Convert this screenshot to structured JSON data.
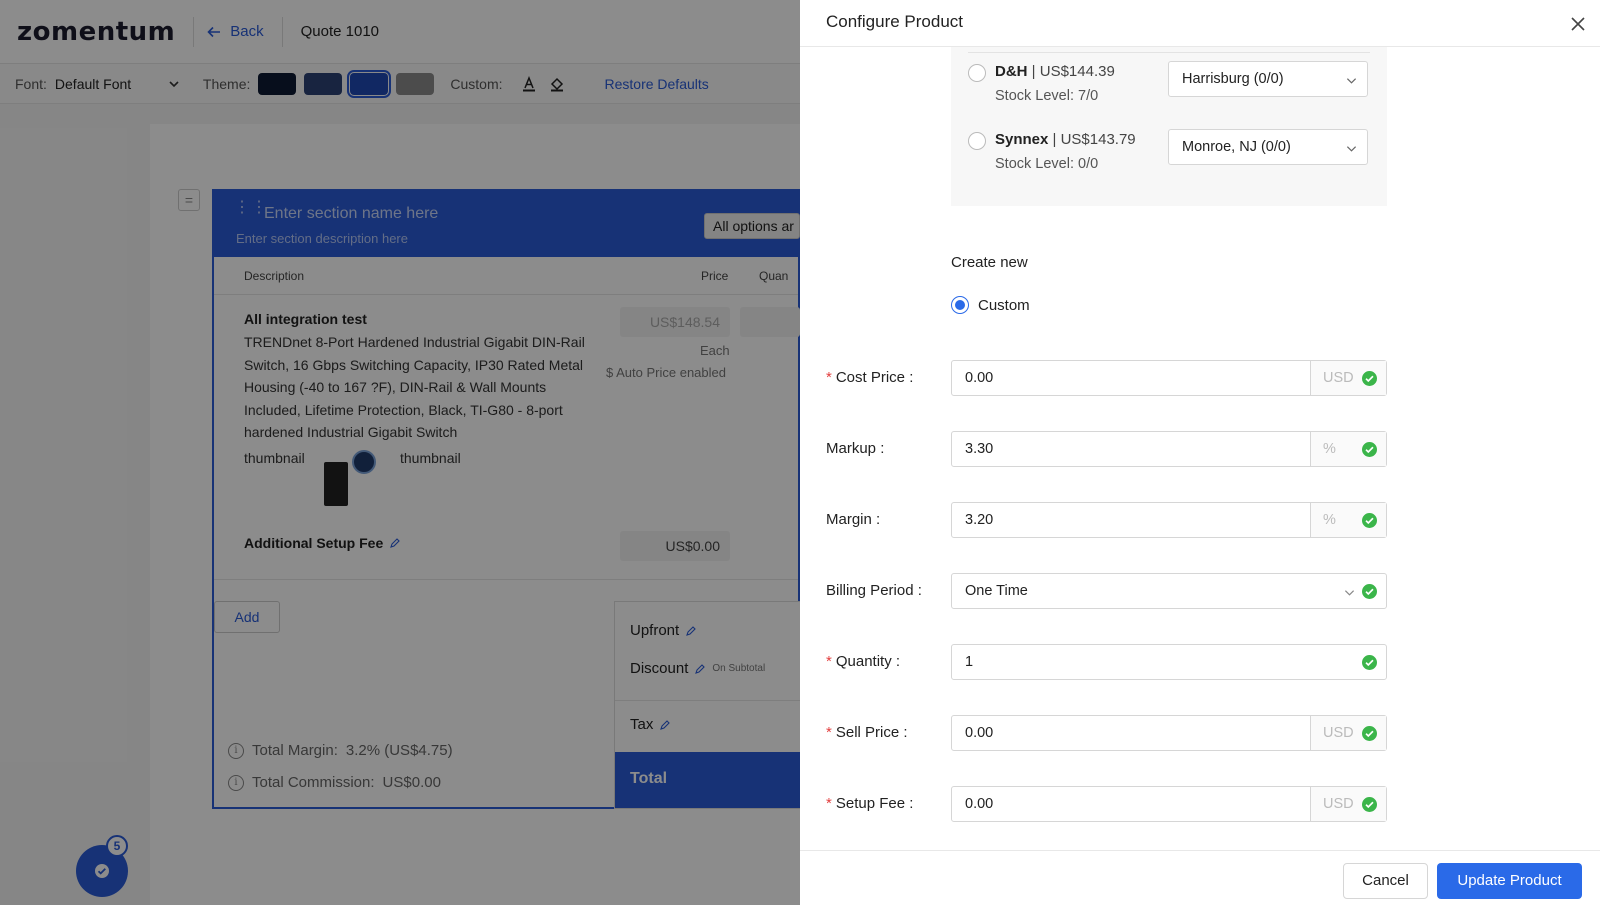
{
  "app": {
    "logo": "zomentum",
    "back_label": "Back",
    "quote_title": "Quote 1010"
  },
  "toolbar": {
    "font_label": "Font:",
    "font_value": "Default Font",
    "theme_label": "Theme:",
    "theme_swatches": [
      "#0e1a33",
      "#2c4275",
      "#1f49b5",
      "#8a8a8a"
    ],
    "custom_label": "Custom:",
    "restore_label": "Restore Defaults"
  },
  "section": {
    "name_placeholder": "Enter section name here",
    "description_placeholder": "Enter section description here",
    "options_pill": "All options ar",
    "columns": {
      "description": "Description",
      "price": "Price",
      "quantity": "Quan"
    },
    "item": {
      "title": "All integration test",
      "description": "TRENDnet 8-Port Hardened Industrial Gigabit DIN-Rail Switch, 16 Gbps Switching Capacity, IP30 Rated Metal Housing (-40 to 167 ?F), DIN-Rail & Wall Mounts Included, Lifetime Protection, Black, TI-G80 - 8-port hardened Industrial Gigabit Switch",
      "price": "US$148.54",
      "unit": "Each",
      "auto_price": "$ Auto Price enabled",
      "thumbnails": [
        "thumbnail",
        "thumbnail"
      ],
      "setup_fee_label": "Additional Setup Fee",
      "setup_fee_value": "US$0.00"
    },
    "add_label": "Add",
    "summary": {
      "upfront": "Upfront",
      "discount": "Discount",
      "on_subtotal": "On Subtotal",
      "tax": "Tax",
      "total": "Total"
    },
    "total_margin_label": "Total Margin:",
    "total_margin_value": "3.2% (US$4.75)",
    "total_commission_label": "Total Commission:",
    "total_commission_value": "US$0.00"
  },
  "fab": {
    "badge_count": "5"
  },
  "drawer": {
    "title": "Configure Product",
    "suppliers": [
      {
        "name": "D&H",
        "price": "| US$144.39",
        "stock": "Stock Level: 7/0",
        "warehouse": "Harrisburg (0/0)"
      },
      {
        "name": "Synnex",
        "price": "| US$143.79",
        "stock": "Stock Level: 0/0",
        "warehouse": "Monroe, NJ (0/0)"
      }
    ],
    "create_new_label": "Create new",
    "custom_option": "Custom",
    "fields": {
      "cost_price": {
        "label": "Cost Price",
        "value": "0.00",
        "unit": "USD",
        "required": true
      },
      "markup": {
        "label": "Markup",
        "value": "3.30",
        "unit": "%",
        "required": false
      },
      "margin": {
        "label": "Margin",
        "value": "3.20",
        "unit": "%",
        "required": false
      },
      "billing_period": {
        "label": "Billing Period",
        "value": "One Time",
        "required": false
      },
      "quantity": {
        "label": "Quantity",
        "value": "1",
        "required": true
      },
      "sell_price": {
        "label": "Sell Price",
        "value": "0.00",
        "unit": "USD",
        "required": true
      },
      "setup_fee": {
        "label": "Setup Fee",
        "value": "0.00",
        "unit": "USD",
        "required": true
      }
    },
    "colon": ":",
    "required_mark": "*",
    "cancel_label": "Cancel",
    "update_label": "Update Product"
  },
  "colors": {
    "primary": "#2a5bd7",
    "button_primary": "#2a6ae8",
    "success_check": "#3bb54a",
    "required": "#e34040"
  }
}
